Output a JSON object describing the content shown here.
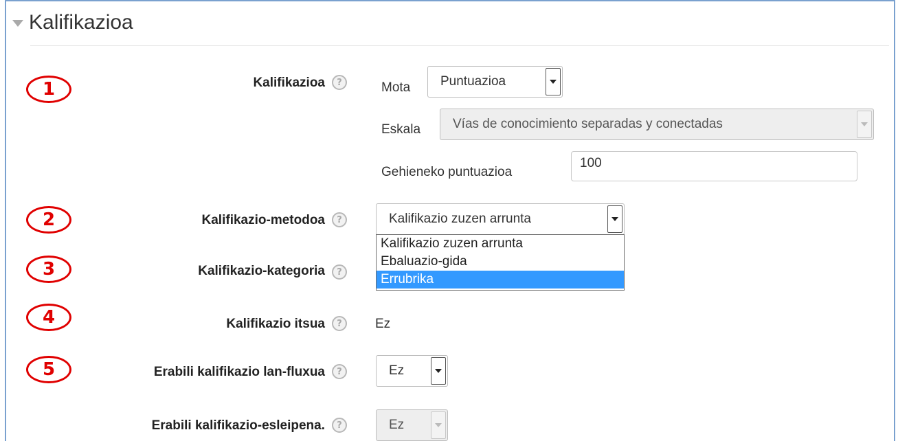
{
  "section": {
    "title": "Kalifikazioa"
  },
  "annotations": [
    "1",
    "2",
    "3",
    "4",
    "5"
  ],
  "rows": {
    "grade": {
      "label": "Kalifikazioa",
      "type_label": "Mota",
      "type_value": "Puntuazioa",
      "scale_label": "Eskala",
      "scale_value": "Vías de conocimiento separadas y conectadas",
      "max_label": "Gehieneko puntuazioa",
      "max_value": "100"
    },
    "method": {
      "label": "Kalifikazio-metodoa",
      "value": "Kalifikazio zuzen arrunta",
      "options": [
        "Kalifikazio zuzen arrunta",
        "Ebaluazio-gida",
        "Errubrika"
      ],
      "highlighted_option": "Errubrika"
    },
    "category": {
      "label": "Kalifikazio-kategoria"
    },
    "blind": {
      "label": "Kalifikazio itsua",
      "value": "Ez"
    },
    "workflow": {
      "label": "Erabili kalifikazio lan-fluxua",
      "value": "Ez"
    },
    "allocation": {
      "label": "Erabili kalifikazio-esleipena.",
      "value": "Ez"
    }
  },
  "help_icon": "question-circle-icon",
  "colors": {
    "highlight": "#3399ff",
    "annotation": "#e00000",
    "frame": "#7aa1cf"
  }
}
